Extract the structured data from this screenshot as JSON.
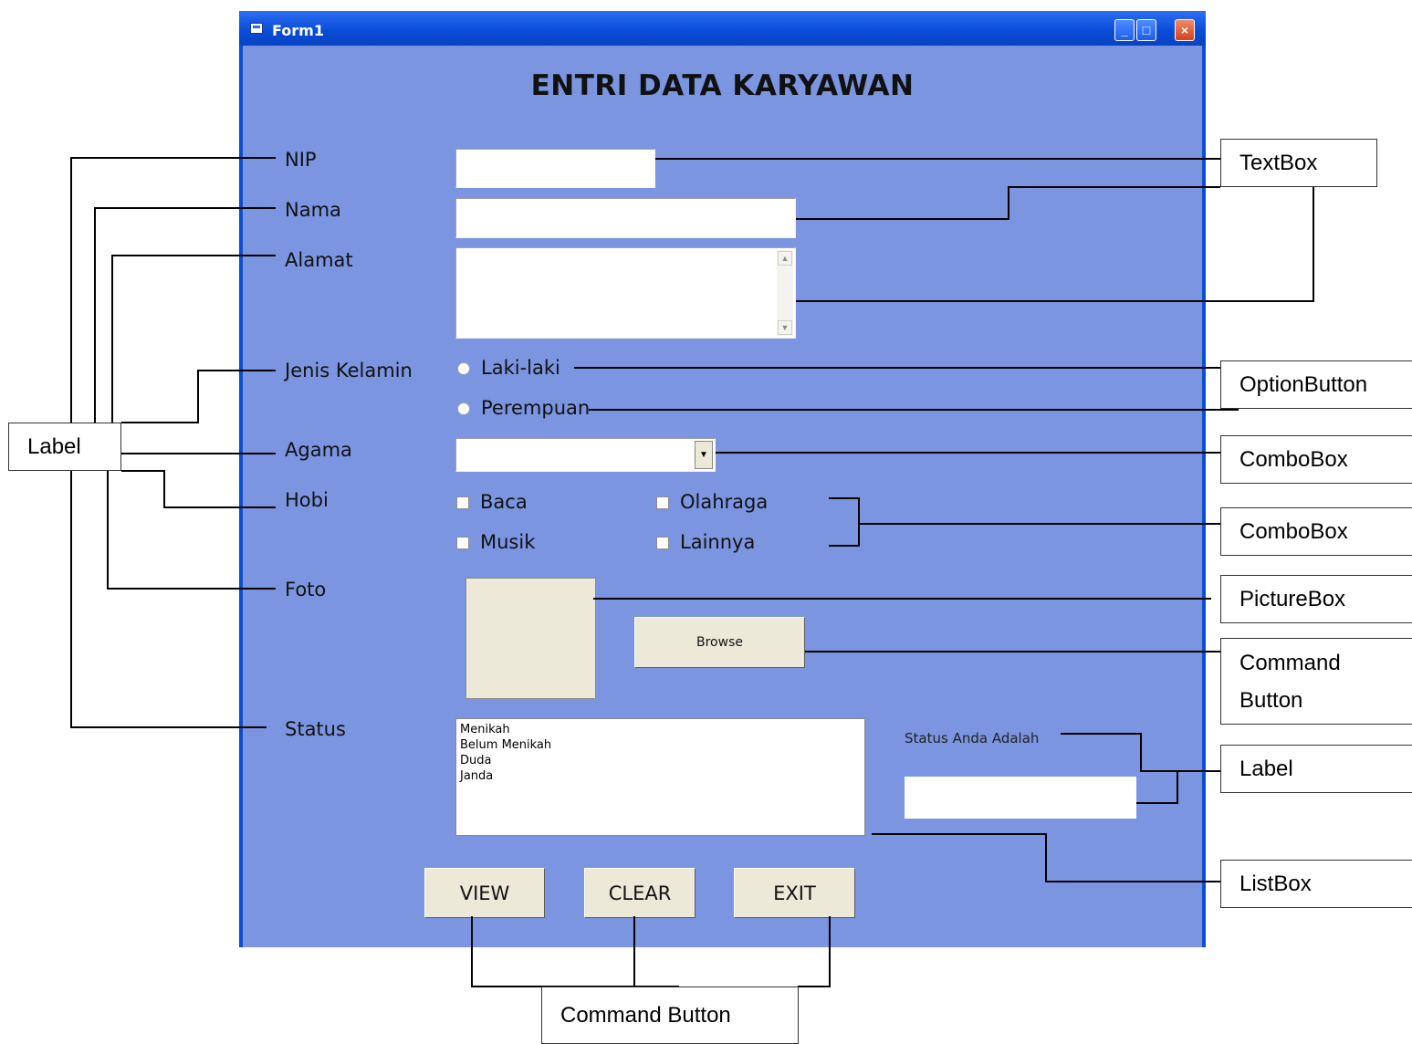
{
  "window": {
    "title": "Form1",
    "minimize": "_",
    "maximize": "□",
    "close": "×",
    "heading": "ENTRI DATA KARYAWAN"
  },
  "labels": {
    "nip": "NIP",
    "nama": "Nama",
    "alamat": "Alamat",
    "jenis_kelamin": "Jenis Kelamin",
    "agama": "Agama",
    "hobi": "Hobi",
    "foto": "Foto",
    "status": "Status"
  },
  "options": {
    "laki": "Laki-laki",
    "perempuan": "Perempuan"
  },
  "hobi": {
    "baca": "Baca",
    "olahraga": "Olahraga",
    "musik": "Musik",
    "lainnya": "Lainnya"
  },
  "buttons": {
    "browse": "Browse",
    "view": "VIEW",
    "clear": "CLEAR",
    "exit": "EXIT"
  },
  "status_list": [
    "Menikah",
    "Belum Menikah",
    "Duda",
    "Janda"
  ],
  "status_result_label": "Status Anda Adalah",
  "annotations": {
    "label_left": "Label",
    "textbox": "TextBox",
    "optionbutton": "OptionButton",
    "combobox1": "ComboBox",
    "combobox2": "ComboBox",
    "picturebox": "PictureBox",
    "command_line1": "Command",
    "command_line2": "Button",
    "label_right": "Label",
    "listbox": "ListBox",
    "command_bottom": "Command Button"
  },
  "colors": {
    "form_background": "#7b95e0",
    "titlebar": "#0a4bd6"
  }
}
